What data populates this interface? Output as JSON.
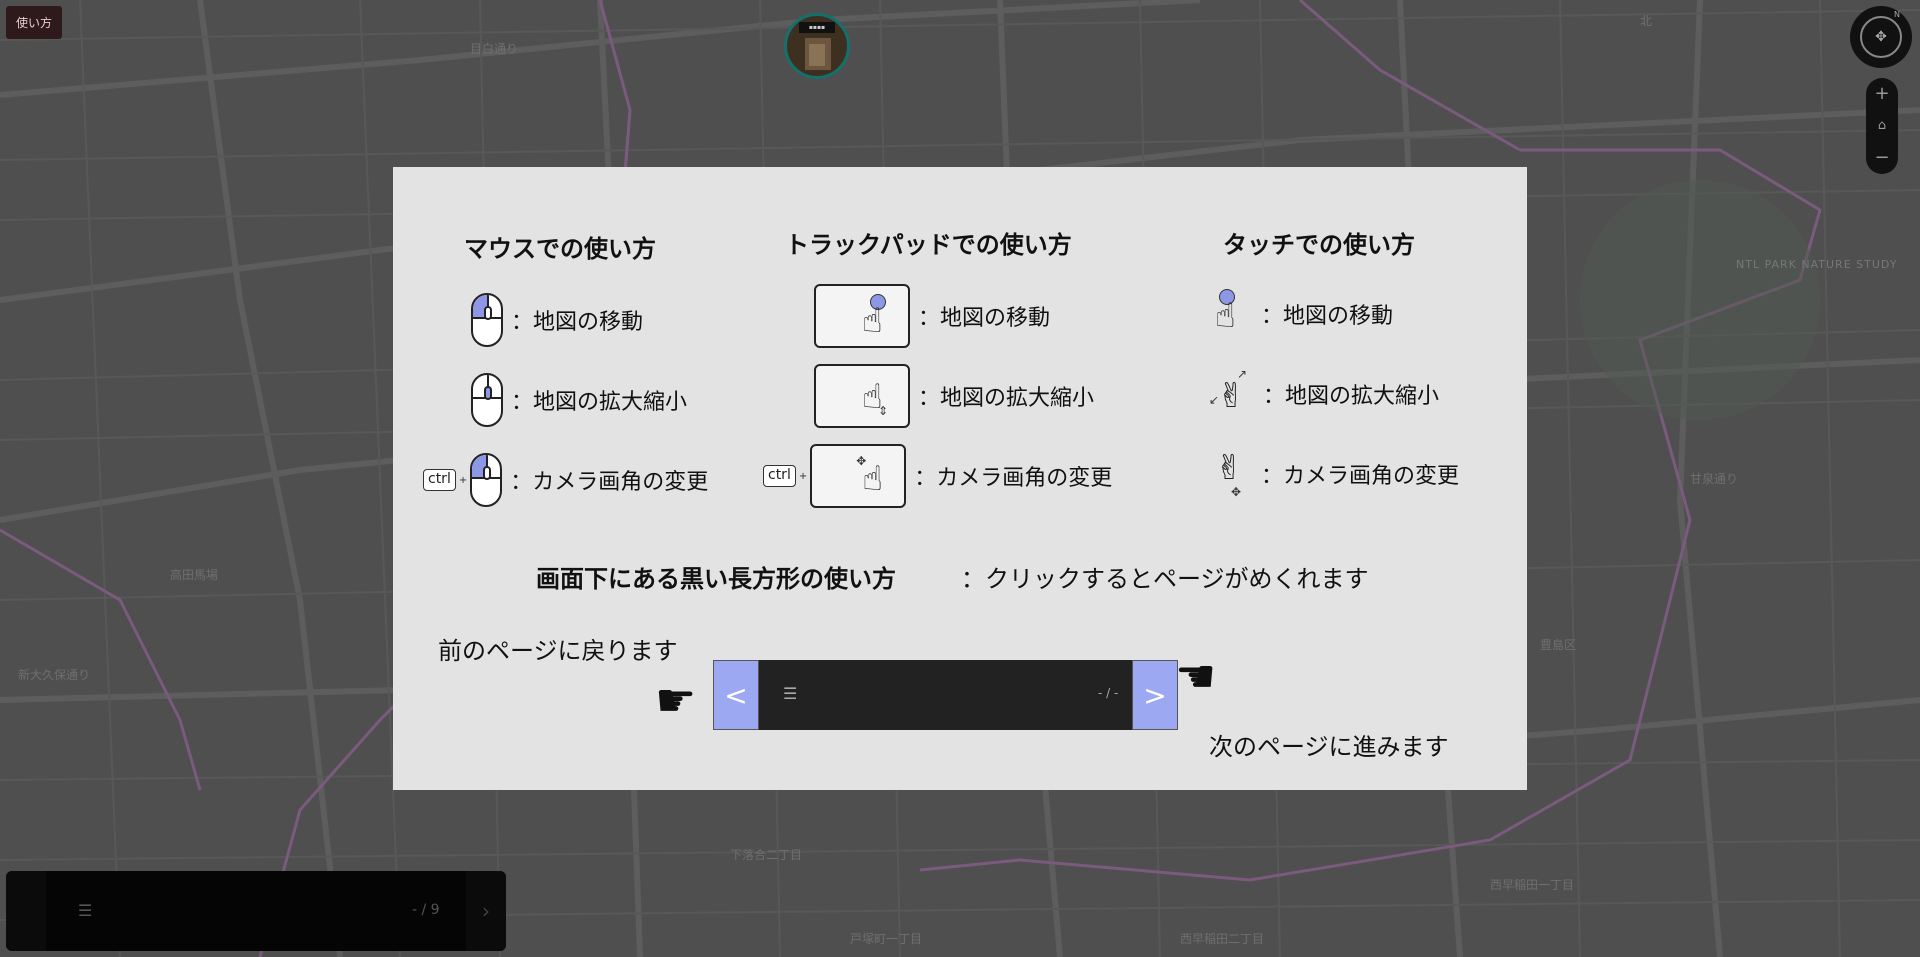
{
  "app": {
    "howto_button_label": "使い方"
  },
  "map_labels": {
    "l1": "北",
    "l2": "NTL PARK NATURE STUDY",
    "l3": "甘泉通り",
    "l4": "高田馬場",
    "l5": "新大久保通り",
    "l6": "目白通り",
    "l7": "下落合二丁目",
    "l8": "西早稲田一丁目",
    "l9": "豊島区",
    "l10": "戸塚町一丁目",
    "l11": "西早稲田二丁目"
  },
  "controls": {
    "compass_north": "N",
    "zoom_in": "+",
    "zoom_home": "⌂",
    "zoom_out": "−"
  },
  "pager": {
    "list_icon": "list-icon",
    "count": "- / 9",
    "next": "›"
  },
  "modal": {
    "mouse": {
      "title": "マウスでの使い方",
      "move": "：地図の移動",
      "zoom": "：地図の拡大縮小",
      "camera": "：カメラ画角の変更",
      "ctrl_key": "ctrl"
    },
    "trackpad": {
      "title": "トラックパッドでの使い方",
      "move": "：地図の移動",
      "zoom": "：地図の拡大縮小",
      "camera": "：カメラ画角の変更",
      "ctrl_key": "ctrl"
    },
    "touch": {
      "title": "タッチでの使い方",
      "move": "：地図の移動",
      "zoom": "：地図の拡大縮小",
      "camera": "：カメラ画角の変更"
    },
    "bar_section": {
      "title": "画面下にある黒い長方形の使い方",
      "description": "：クリックするとページがめくれます",
      "prev_label": "前のページに戻ります",
      "next_label": "次のページに進みます",
      "demo_prev": "<",
      "demo_next": ">",
      "demo_count": "- / -"
    }
  },
  "colors": {
    "highlight": "#8e97e6",
    "modal_bg": "#e3e3e3",
    "page_bg": "#505050"
  }
}
